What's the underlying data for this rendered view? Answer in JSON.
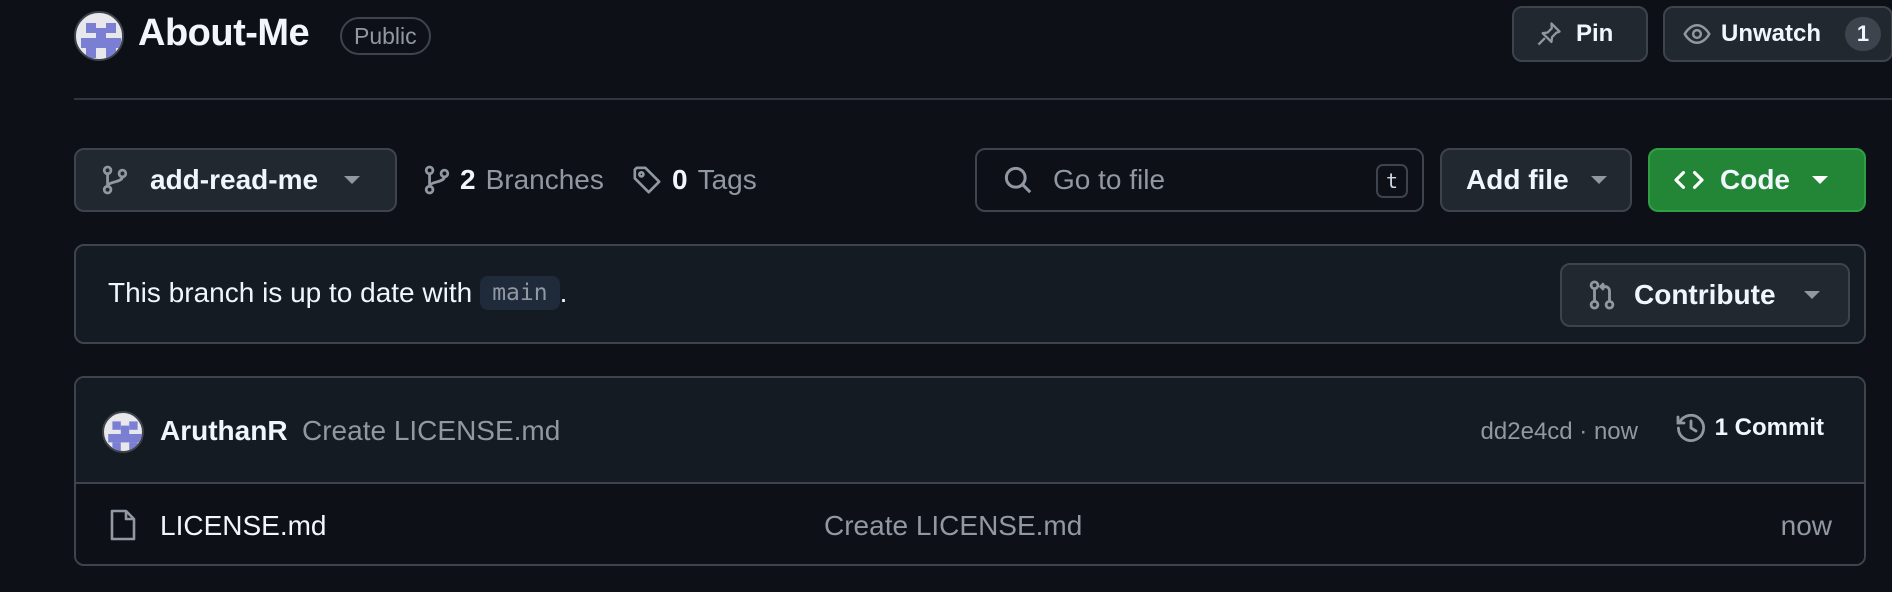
{
  "repo": {
    "name": "About-Me",
    "visibility": "Public"
  },
  "header_actions": {
    "pin_label": "Pin",
    "watch_label": "Unwatch",
    "watch_count": "1"
  },
  "toolbar": {
    "branch_name": "add-read-me",
    "branches_count": "2",
    "branches_label": "Branches",
    "tags_count": "0",
    "tags_label": "Tags",
    "search_placeholder": "Go to file",
    "search_shortcut": "t",
    "add_file_label": "Add file",
    "code_label": "Code"
  },
  "branch_status": {
    "text": "This branch is up to date with",
    "base_branch": "main",
    "suffix": ".",
    "contribute_label": "Contribute"
  },
  "latest_commit": {
    "author": "AruthanR",
    "message": "Create LICENSE.md",
    "sha_time": "dd2e4cd · now",
    "commits_label": "1 Commit"
  },
  "files": [
    {
      "name": "LICENSE.md",
      "commit_message": "Create LICENSE.md",
      "time": "now"
    }
  ],
  "colors": {
    "background": "#0d1117",
    "accent_green": "#238636",
    "border": "#3d444d",
    "muted_text": "#9198a1"
  }
}
